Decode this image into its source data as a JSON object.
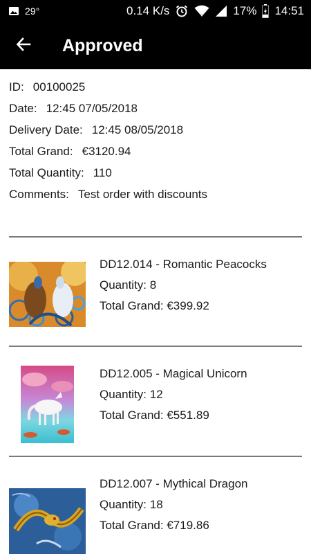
{
  "status_bar": {
    "temperature": "29°",
    "network_speed": "0.14 K/s",
    "battery": "17%",
    "time": "14:51",
    "icons": [
      "image-icon",
      "alarm-icon",
      "wifi-icon",
      "signal-icon",
      "battery-icon"
    ]
  },
  "app_bar": {
    "title": "Approved",
    "back_icon": "arrow-left-icon"
  },
  "order": {
    "id_label": "ID:",
    "id_value": "00100025",
    "date_label": "Date:",
    "date_value": "12:45 07/05/2018",
    "delivery_label": "Delivery Date:",
    "delivery_value": "12:45 08/05/2018",
    "total_label": "Total Grand:",
    "total_value": "€3120.94",
    "quantity_label": "Total Quantity:",
    "quantity_value": "110",
    "comments_label": "Comments:",
    "comments_value": "Test order with discounts"
  },
  "products": [
    {
      "name": "DD12.014 - Romantic Peacocks",
      "quantity": "Quantity: 8",
      "total": "Total Grand: €399.92",
      "image": "peacocks-painting"
    },
    {
      "name": "DD12.005 - Magical Unicorn",
      "quantity": "Quantity: 12",
      "total": "Total Grand: €551.89",
      "image": "unicorn-painting"
    },
    {
      "name": "DD12.007 - Mythical Dragon",
      "quantity": "Quantity: 18",
      "total": "Total Grand: €719.86",
      "image": "dragon-painting"
    }
  ],
  "colors": {
    "bar_background": "#000000",
    "divider": "#7a7a7a",
    "text": "#1a1a1a"
  }
}
